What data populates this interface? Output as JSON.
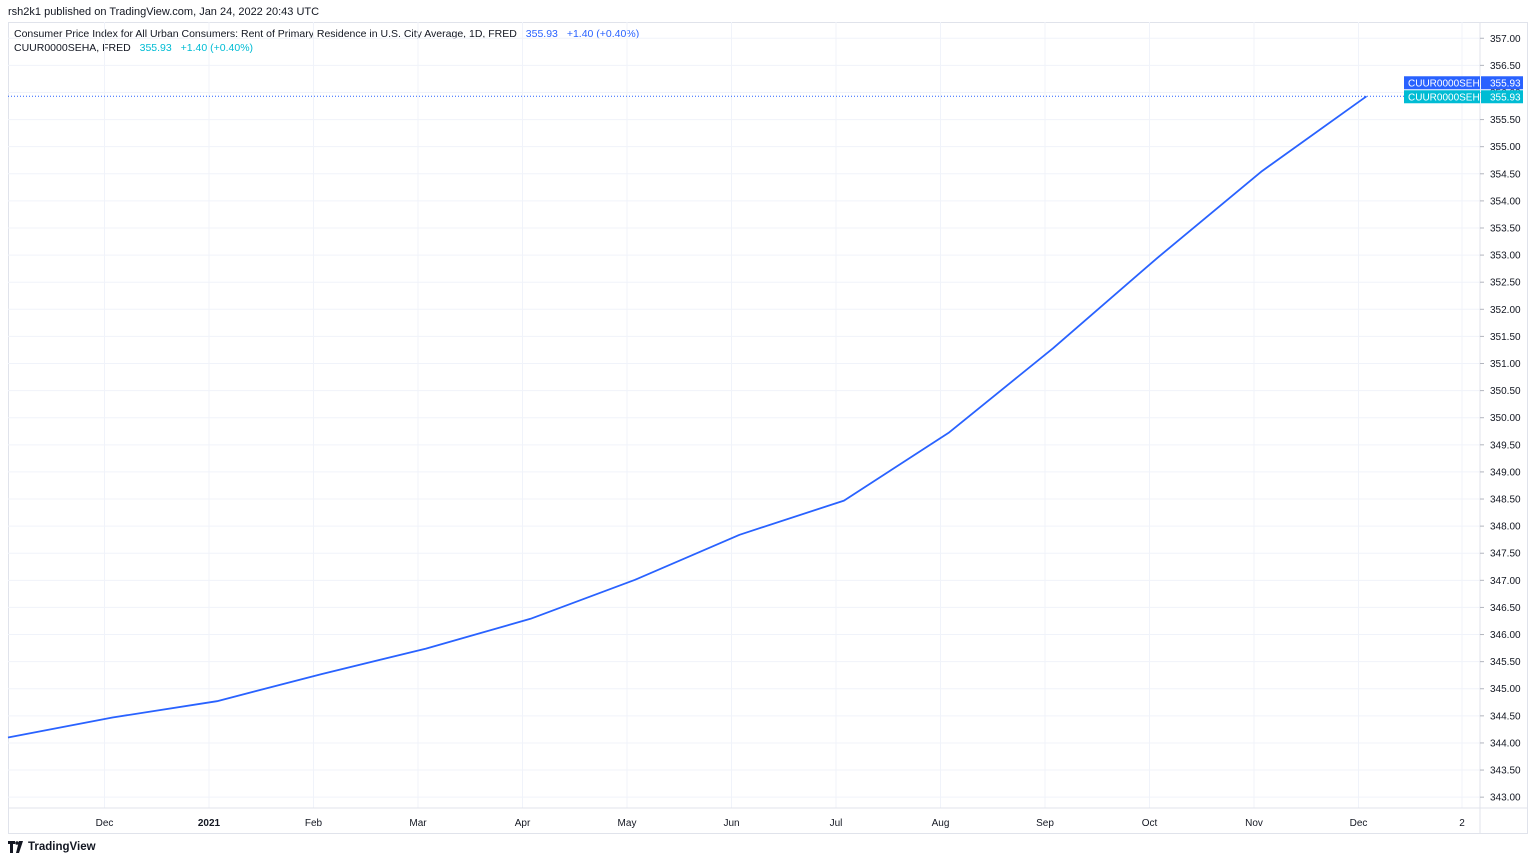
{
  "header": {
    "publish_text": "rsh2k1 published on TradingView.com, Jan 24, 2022 20:43 UTC"
  },
  "legend": [
    {
      "title": "Consumer Price Index for All Urban Consumers: Rent of Primary Residence in U.S. City Average, 1D, FRED",
      "value": "355.93",
      "change": "+1.40 (+0.40%)",
      "color": "#2962ff"
    },
    {
      "title": "CUUR0000SEHA, FRED",
      "value": "355.93",
      "change": "+1.40 (+0.40%)",
      "color": "#00bcd4"
    }
  ],
  "footer": {
    "brand": "TradingView"
  },
  "chart_data": {
    "type": "line",
    "x_tick_labels": [
      "Dec",
      "2021",
      "Feb",
      "Mar",
      "Apr",
      "May",
      "Jun",
      "Jul",
      "Aug",
      "Sep",
      "Oct",
      "Nov",
      "Dec",
      "2"
    ],
    "x_tick_bold": [
      false,
      true,
      false,
      false,
      false,
      false,
      false,
      false,
      false,
      false,
      false,
      false,
      false,
      false
    ],
    "x": [
      "2020-11",
      "2020-12",
      "2021-01",
      "2021-02",
      "2021-03",
      "2021-04",
      "2021-05",
      "2021-06",
      "2021-07",
      "2021-08",
      "2021-09",
      "2021-10",
      "2021-11",
      "2021-12"
    ],
    "series": [
      {
        "values": [
          344.1,
          344.47,
          344.77,
          345.27,
          345.74,
          346.29,
          347.01,
          347.84,
          348.47,
          349.72,
          351.28,
          352.95,
          354.55,
          355.93
        ],
        "color": "#2962ff"
      }
    ],
    "ylim": [
      342.8,
      357.3
    ],
    "y_ticks": [
      "343.00",
      "343.50",
      "344.00",
      "344.50",
      "345.00",
      "345.50",
      "346.00",
      "346.50",
      "347.00",
      "347.50",
      "348.00",
      "348.50",
      "349.00",
      "349.50",
      "350.00",
      "350.50",
      "351.00",
      "351.50",
      "352.00",
      "352.50",
      "353.00",
      "353.50",
      "354.00",
      "354.50",
      "355.00",
      "355.50",
      "356.00",
      "356.50",
      "357.00"
    ],
    "last_value_labels": [
      {
        "name": "CUUR0000SEHA",
        "value": "355.93",
        "color": "#2962ff"
      },
      {
        "name": "CUUR0000SEHA",
        "value": "355.93",
        "color": "#00bcd4"
      }
    ],
    "grid": true
  }
}
